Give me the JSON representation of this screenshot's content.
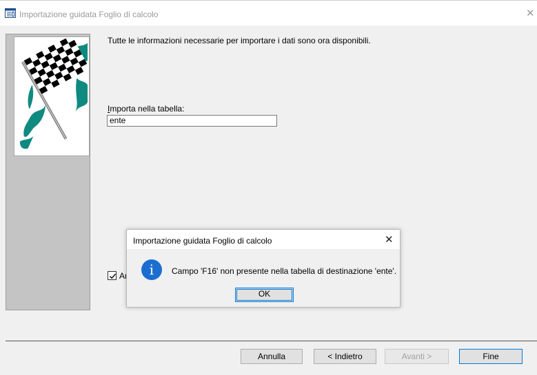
{
  "window": {
    "title": "Importazione guidata Foglio di calcolo",
    "close_glyph": "✕",
    "icon": "table-wizard-icon"
  },
  "wizard": {
    "intro": "Tutte le informazioni necessarie per importare i dati sono ora disponibili.",
    "table_label_accel": "I",
    "table_label_rest": "mporta nella tabella:",
    "table_value": "ente",
    "checkbox_checked": true,
    "checkbox_label_visible": "An"
  },
  "buttons": {
    "cancel": "Annulla",
    "back": "< Indietro",
    "next": "Avanti >",
    "finish": "Fine"
  },
  "dialog": {
    "title": "Importazione guidata Foglio di calcolo",
    "close_glyph": "✕",
    "icon": "info-icon",
    "icon_glyph": "i",
    "message": "Campo 'F16' non presente nella tabella di destinazione 'ente'.",
    "ok": "OK"
  },
  "colors": {
    "accent": "#0078d7",
    "info_icon": "#1b6ed0",
    "flag_teal": "#0f8a80"
  }
}
